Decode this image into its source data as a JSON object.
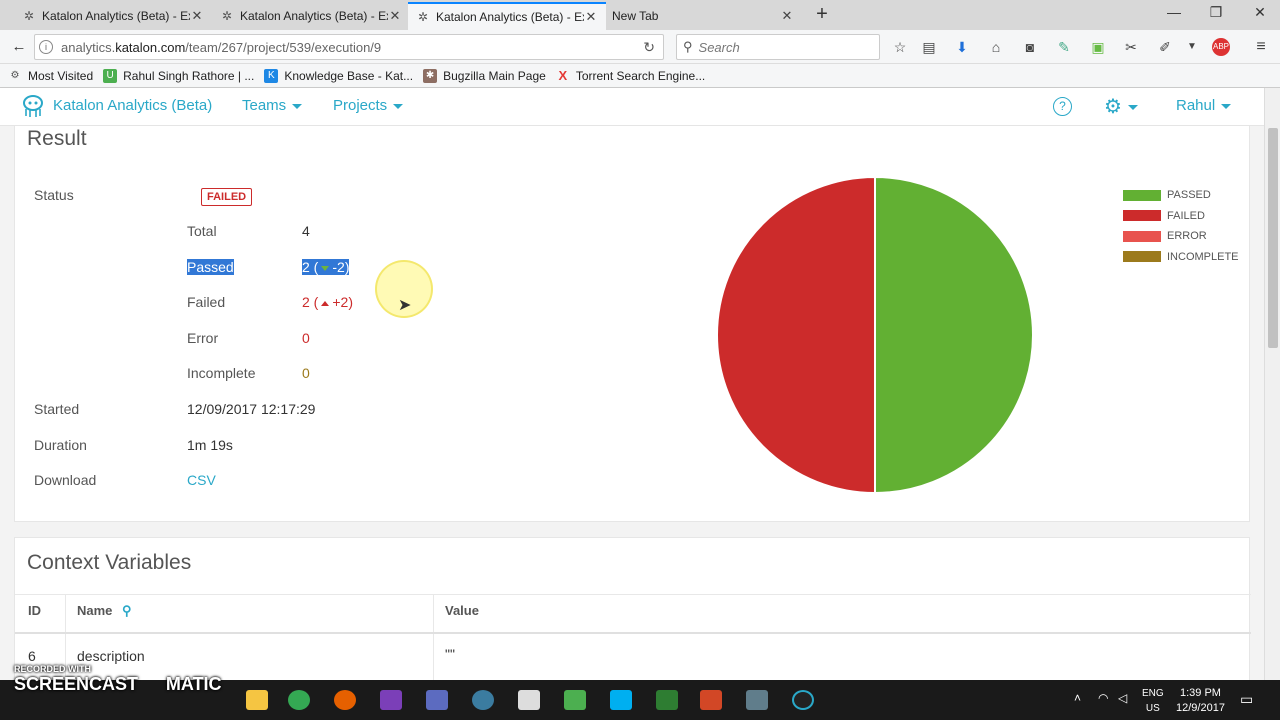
{
  "browser": {
    "tabs": [
      {
        "title": "Katalon Analytics (Beta) - Ex",
        "active": false
      },
      {
        "title": "Katalon Analytics (Beta) - Ex",
        "active": false
      },
      {
        "title": "Katalon Analytics (Beta) - Ex",
        "active": true
      },
      {
        "title": "New Tab",
        "active": false
      }
    ],
    "url_prefix": "analytics.",
    "url_domain": "katalon.com",
    "url_path": "/team/267/project/539/execution/9",
    "search_placeholder": "Search",
    "bookmarks": [
      {
        "label": "Most Visited",
        "icon": "gear-icon",
        "color": "#555555"
      },
      {
        "label": "Rahul Singh Rathore | ...",
        "icon": "u-icon",
        "color": "#4caf50"
      },
      {
        "label": "Knowledge Base - Kat...",
        "icon": "k-icon",
        "color": "#1e88e5"
      },
      {
        "label": "Bugzilla Main Page",
        "icon": "bug-icon",
        "color": "#8d6e63"
      },
      {
        "label": "Torrent Search Engine...",
        "icon": "x-icon",
        "color": "#e53935"
      }
    ]
  },
  "app": {
    "name": "Katalon Analytics (Beta)",
    "menu": {
      "teams": "Teams",
      "projects": "Projects",
      "user": "Rahul"
    },
    "help": "?"
  },
  "result": {
    "title": "Result",
    "status_label": "Status",
    "status_value": "FAILED",
    "total_label": "Total",
    "total_value": "4",
    "passed_label": "Passed",
    "passed_value": "2",
    "passed_delta": "-2",
    "failed_label": "Failed",
    "failed_value": "2",
    "failed_delta": "+2",
    "error_label": "Error",
    "error_value": "0",
    "incomplete_label": "Incomplete",
    "incomplete_value": "0",
    "started_label": "Started",
    "started_value": "12/09/2017 12:17:29",
    "duration_label": "Duration",
    "duration_value": "1m 19s",
    "download_label": "Download",
    "download_value": "CSV"
  },
  "chart_data": {
    "type": "pie",
    "categories": [
      "PASSED",
      "FAILED",
      "ERROR",
      "INCOMPLETE"
    ],
    "values": [
      2,
      2,
      0,
      0
    ],
    "colors": [
      "#62b033",
      "#cc2b2b",
      "#e8534e",
      "#9c7a1c"
    ],
    "legend": "top-right"
  },
  "context": {
    "title": "Context Variables",
    "headers": {
      "id": "ID",
      "name": "Name",
      "value": "Value"
    },
    "rows": [
      {
        "id": "6",
        "name": "description",
        "value": "\"\""
      }
    ]
  },
  "taskbar": {
    "lang_top": "ENG",
    "lang_bottom": "US",
    "time": "1:39 PM",
    "date": "12/9/2017"
  },
  "watermark": {
    "line1": "RECORDED WITH",
    "line2": "SCREENCAST",
    "line3": "MATIC"
  }
}
